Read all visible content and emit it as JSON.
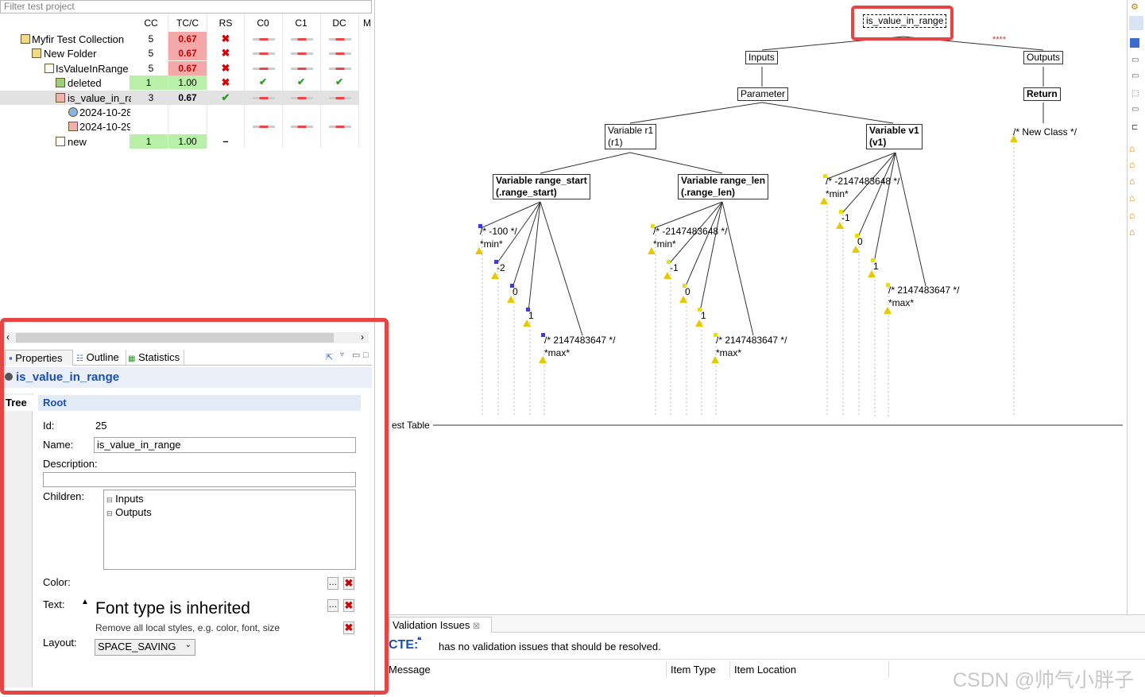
{
  "left_panel": {
    "filter_placeholder": "Filter test project",
    "columns": [
      "CC",
      "TC/C",
      "RS",
      "C0",
      "C1",
      "DC",
      "M"
    ],
    "rows": [
      {
        "label": "Myfir Test Collection",
        "cc": "5",
        "tcc": "0.67",
        "tcc_status": "red",
        "rs": "✖"
      },
      {
        "label": "New Folder",
        "cc": "5",
        "tcc": "0.67",
        "tcc_status": "red",
        "rs": "✖"
      },
      {
        "label": "IsValueInRange",
        "cc": "5",
        "tcc": "0.67",
        "tcc_status": "red",
        "rs": "✖"
      },
      {
        "label": "deleted",
        "cc": "1",
        "tcc": "1.00",
        "tcc_status": "green",
        "rs": "✖"
      },
      {
        "label": "is_value_in_ra",
        "cc": "3",
        "tcc": "0.67",
        "tcc_status": "plain",
        "rs": "✔"
      },
      {
        "label": "2024-10-28",
        "cc": "",
        "tcc": "",
        "tcc_status": "none",
        "rs": ""
      },
      {
        "label": "2024-10-29",
        "cc": "",
        "tcc": "",
        "tcc_status": "none",
        "rs": ""
      },
      {
        "label": "new",
        "cc": "1",
        "tcc": "1.00",
        "tcc_status": "green",
        "rs": "–"
      }
    ],
    "tabs": [
      "Properties",
      "Outline",
      "Statistics"
    ],
    "selected_title": "is_value_in_range",
    "side_tab": "Tree",
    "section_title": "Root",
    "props": {
      "id_label": "Id:",
      "id_value": "25",
      "name_label": "Name:",
      "name_value": "is_value_in_range",
      "description_label": "Description:",
      "children_label": "Children:",
      "children": [
        "Inputs",
        "Outputs"
      ],
      "color_label": "Color:",
      "text_label": "Text:",
      "font_inherited": "Font type is inherited",
      "remove_styles": "Remove all local styles, e.g. color, font, size",
      "layout_label": "Layout:",
      "layout_value": "SPACE_SAVING"
    }
  },
  "canvas": {
    "root": "is_value_in_range",
    "inputs": "Inputs",
    "outputs": "Outputs",
    "parameter": "Parameter",
    "return": "Return",
    "stars": "****",
    "var_r1_line1": "Variable r1",
    "var_r1_line2": "(r1)",
    "var_v1_line1": "Variable v1",
    "var_v1_line2": "(v1)",
    "new_class": "/* New Class */",
    "range_start_line1": "Variable range_start",
    "range_start_line2": "(.range_start)",
    "range_len_line1": "Variable range_len",
    "range_len_line2": "(.range_len)",
    "rs_min_a": "/* -100 */",
    "rs_min_b": "*min*",
    "rs_v1": "-2",
    "rs_v2": "0",
    "rs_v3": "1",
    "rs_max_a": "/* 2147483647 */",
    "rs_max_b": "*max*",
    "rl_min_a": "/* -2147483648 */",
    "rl_min_b": "*min*",
    "rl_v1": "-1",
    "rl_v2": "0",
    "rl_v3": "1",
    "rl_max_a": "/* 2147483647 */",
    "rl_max_b": "*max*",
    "v1_min_a": "/* -2147483648 */",
    "v1_min_b": "*min*",
    "v1_v1": "-1",
    "v1_v2": "0",
    "v1_v3": "1",
    "v1_max_a": "/* 2147483647 */",
    "v1_max_b": "*max*",
    "test_table": "est Table"
  },
  "bottom": {
    "tab": "Validation Issues",
    "prefix": "CTE:",
    "message": "has no validation issues that should be resolved.",
    "col_message": "Message",
    "col_item_type": "Item Type",
    "col_item_location": "Item Location"
  },
  "watermark": "CSDN @帅气小胖子",
  "colors": {
    "highlight": "#e84444",
    "red_cell": "#f4a8a8",
    "green_cell": "#b8f0a8",
    "link_blue": "#1a4fb0"
  }
}
